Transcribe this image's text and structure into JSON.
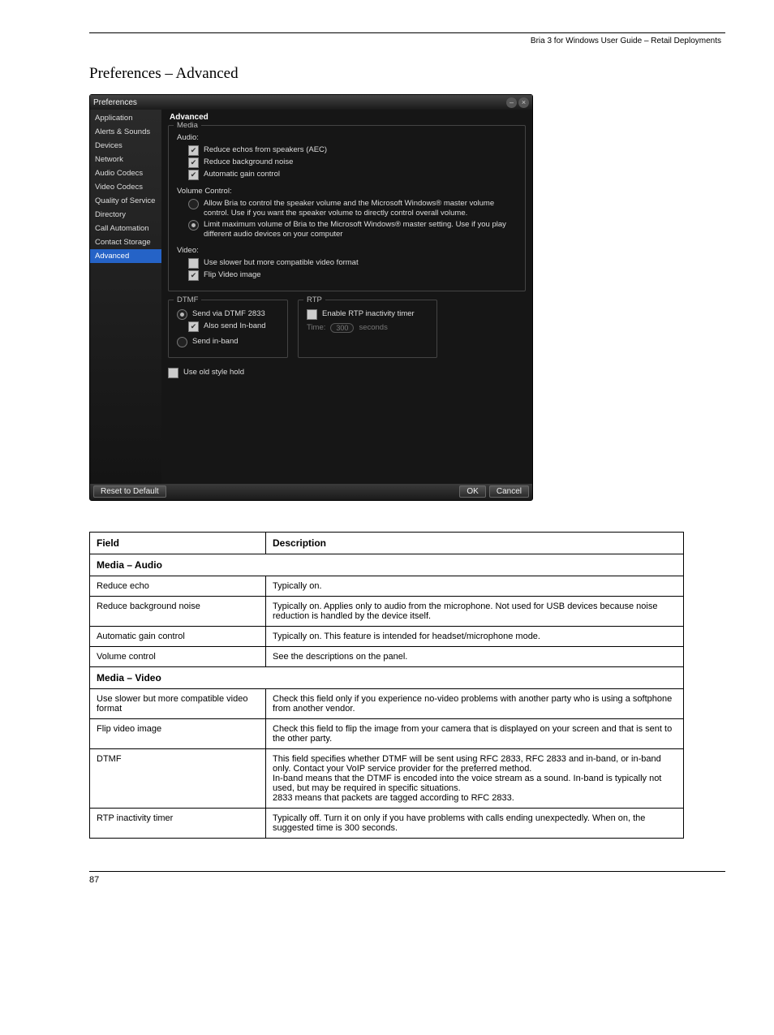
{
  "header": {
    "text": "Bria 3 for Windows User Guide – Retail Deployments"
  },
  "section_title": "Preferences – Advanced",
  "win": {
    "title": "Preferences",
    "sidebar": [
      "Application",
      "Alerts & Sounds",
      "Devices",
      "Network",
      "Audio Codecs",
      "Video Codecs",
      "Quality of Service",
      "Directory",
      "Call Automation",
      "Contact Storage",
      "Advanced"
    ],
    "selected_sidebar_index": 10,
    "content_title": "Advanced",
    "media": {
      "legend": "Media",
      "audio_label": "Audio:",
      "audio_cb": [
        {
          "label": "Reduce echos from speakers (AEC)",
          "checked": true
        },
        {
          "label": "Reduce background noise",
          "checked": true
        },
        {
          "label": "Automatic gain control",
          "checked": true
        }
      ],
      "volctl_label": "Volume Control:",
      "volctl_radios": [
        {
          "label": "Allow Bria to control the speaker volume and the Microsoft Windows® master volume control. Use if you want the speaker volume to directly control overall volume.",
          "sel": false
        },
        {
          "label": "Limit maximum volume of Bria to the Microsoft Windows® master setting. Use if you play different audio devices on your computer",
          "sel": true
        }
      ],
      "video_label": "Video:",
      "video_cb": [
        {
          "label": "Use slower but more compatible video format",
          "checked": false
        },
        {
          "label": "Flip Video image",
          "checked": true
        }
      ]
    },
    "dtmf": {
      "legend": "DTMF",
      "r1": {
        "label": "Send via DTMF 2833",
        "sel": true
      },
      "cb": {
        "label": "Also send In-band",
        "checked": true
      },
      "r2": {
        "label": "Send in-band",
        "sel": false
      }
    },
    "rtp": {
      "legend": "RTP",
      "cb": {
        "label": "Enable RTP inactivity timer",
        "checked": false
      },
      "time_label": "Time:",
      "time_value": "300",
      "seconds": "seconds"
    },
    "old_hold": {
      "label": "Use old style hold",
      "checked": false
    },
    "buttons": {
      "reset": "Reset to Default",
      "ok": "OK",
      "cancel": "Cancel"
    }
  },
  "table": {
    "head": [
      "Field",
      "Description"
    ],
    "rows": [
      {
        "section": "Media – Audio"
      },
      {
        "f": "Reduce echo",
        "d": "Typically on."
      },
      {
        "f": "Reduce background noise",
        "d": "Typically on. Applies only to audio from the microphone. Not used for USB devices because noise reduction is handled by the device itself."
      },
      {
        "f": "Automatic gain control",
        "d": "Typically on. This feature is intended for headset/microphone mode."
      },
      {
        "f": "Volume control",
        "d": "See the descriptions on the panel."
      },
      {
        "section": "Media – Video"
      },
      {
        "f": "Use slower but more compatible video format",
        "d": "Check this field only if you experience no-video problems with another party who is using a softphone from another vendor."
      },
      {
        "f": "Flip video image",
        "d": "Check this field to flip the image from your camera that is displayed on your screen and that is sent to the other party."
      },
      {
        "f": "DTMF",
        "d": "This field specifies whether DTMF will be sent using RFC 2833, RFC 2833 and in-band, or in-band only. Contact your VoIP service provider for the preferred method.\nIn-band means that the DTMF is encoded into the voice stream as a sound. In-band is typically not used, but may be required in specific situations.\n2833 means that packets are tagged according to RFC 2833."
      },
      {
        "f": "RTP inactivity timer",
        "d": "Typically off. Turn it on only if you have problems with calls ending unexpectedly. When on, the suggested time is 300 seconds."
      }
    ]
  },
  "footer": {
    "page": "87"
  }
}
